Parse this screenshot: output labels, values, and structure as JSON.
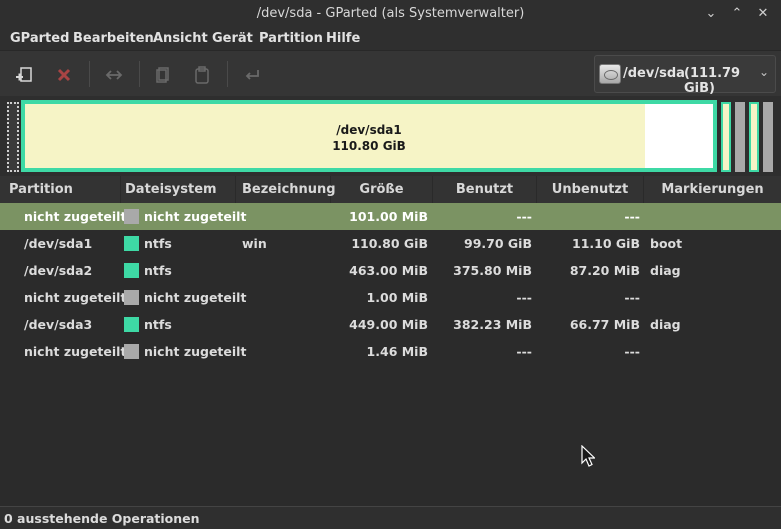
{
  "window": {
    "title": "/dev/sda - GParted (als Systemverwalter)"
  },
  "menu": [
    "GParted",
    "Bearbeiten",
    "Ansicht",
    "Gerät",
    "Partition",
    "Hilfe"
  ],
  "toolbar": {
    "buttons": [
      "new-partition-icon",
      "delete-icon",
      "resize-move-icon",
      "copy-icon",
      "paste-icon",
      "undo-icon"
    ]
  },
  "device": {
    "name": "/dev/sda",
    "size": "(111.79 GiB)"
  },
  "diskmap": {
    "selected_label": "/dev/sda1",
    "selected_size": "110.80 GiB",
    "colors": {
      "ntfs": "#3ed9a5",
      "unallocated": "#a9a9a9",
      "used": "#f6f4c6"
    }
  },
  "table": {
    "headers": [
      "Partition",
      "Dateisystem",
      "Bezeichnung",
      "Größe",
      "Benutzt",
      "Unbenutzt",
      "Markierungen"
    ],
    "rows": [
      {
        "partition": "nicht zugeteilt",
        "fs": "nicht zugeteilt",
        "fs_color": "#a9a9a9",
        "label": "",
        "size": "101.00 MiB",
        "used": "---",
        "unused": "---",
        "flags": ""
      },
      {
        "partition": "/dev/sda1",
        "fs": "ntfs",
        "fs_color": "#3ed9a5",
        "label": "win",
        "size": "110.80 GiB",
        "used": "99.70 GiB",
        "unused": "11.10 GiB",
        "flags": "boot"
      },
      {
        "partition": "/dev/sda2",
        "fs": "ntfs",
        "fs_color": "#3ed9a5",
        "label": "",
        "size": "463.00 MiB",
        "used": "375.80 MiB",
        "unused": "87.20 MiB",
        "flags": "diag"
      },
      {
        "partition": "nicht zugeteilt",
        "fs": "nicht zugeteilt",
        "fs_color": "#a9a9a9",
        "label": "",
        "size": "1.00 MiB",
        "used": "---",
        "unused": "---",
        "flags": ""
      },
      {
        "partition": "/dev/sda3",
        "fs": "ntfs",
        "fs_color": "#3ed9a5",
        "label": "",
        "size": "449.00 MiB",
        "used": "382.23 MiB",
        "unused": "66.77 MiB",
        "flags": "diag"
      },
      {
        "partition": "nicht zugeteilt",
        "fs": "nicht zugeteilt",
        "fs_color": "#a9a9a9",
        "label": "",
        "size": "1.46 MiB",
        "used": "---",
        "unused": "---",
        "flags": ""
      }
    ]
  },
  "status": {
    "text": "0 ausstehende Operationen"
  }
}
